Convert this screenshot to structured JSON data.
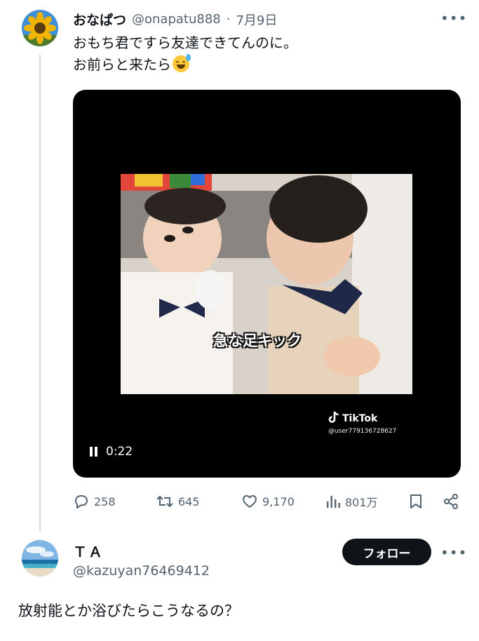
{
  "tweet": {
    "author_name": "おなぱつ",
    "handle": "@onapatu888",
    "separator": "·",
    "date": "7月9日",
    "more_label": "•••",
    "line1": "おもち君ですら友達できてんのに。",
    "line2": "お前らと来たら",
    "emoji_icon": "grinning-face-with-sweat",
    "media": {
      "caption": "急な足キック",
      "watermark": "TikTok",
      "watermark_user": "@user779136728627",
      "time": "0:22"
    },
    "stats": {
      "replies": "258",
      "reposts": "645",
      "likes": "9,170",
      "views": "801万"
    }
  },
  "reply": {
    "display_name": "ＴＡ",
    "handle": "@kazuyan76469412",
    "follow_label": "フォロー",
    "more_label": "•••",
    "text": "放射能とか浴びたらこうなるの？"
  },
  "colors": {
    "text": "#0f1419",
    "muted": "#536471",
    "thread_line": "#cfd9de",
    "button_bg": "#0f1419"
  }
}
